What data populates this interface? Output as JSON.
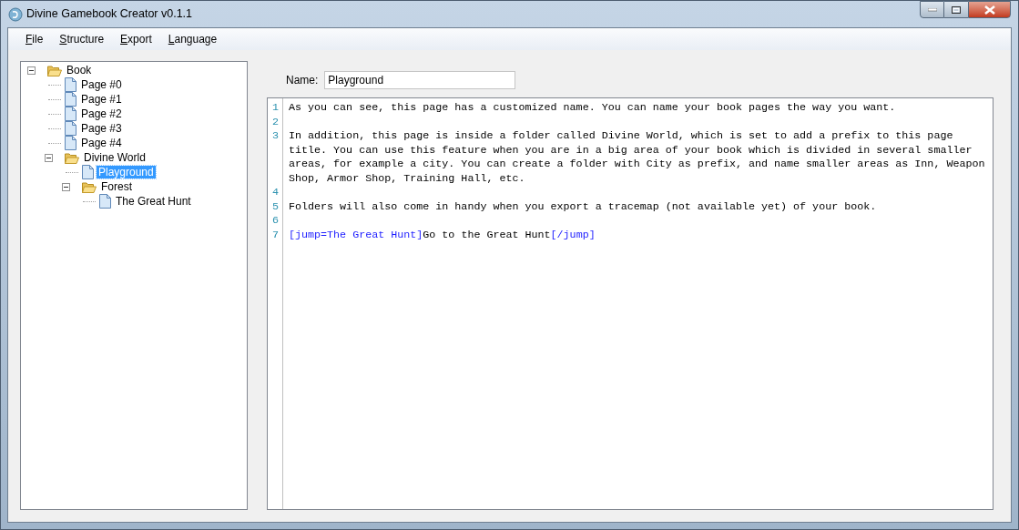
{
  "window": {
    "title": "Divine Gamebook Creator v0.1.1"
  },
  "menu": [
    {
      "label": "File"
    },
    {
      "label": "Structure"
    },
    {
      "label": "Export"
    },
    {
      "label": "Language"
    }
  ],
  "tree": [
    {
      "kind": "folder",
      "label": "Book",
      "expanded": true,
      "selected": false,
      "children": [
        {
          "kind": "page",
          "label": "Page #0",
          "selected": false
        },
        {
          "kind": "page",
          "label": "Page #1",
          "selected": false
        },
        {
          "kind": "page",
          "label": "Page #2",
          "selected": false
        },
        {
          "kind": "page",
          "label": "Page #3",
          "selected": false
        },
        {
          "kind": "page",
          "label": "Page #4",
          "selected": false
        },
        {
          "kind": "folder",
          "label": "Divine World",
          "expanded": true,
          "selected": false,
          "children": [
            {
              "kind": "page",
              "label": "Playground",
              "selected": true
            },
            {
              "kind": "folder",
              "label": "Forest",
              "expanded": true,
              "selected": false,
              "children": [
                {
                  "kind": "page",
                  "label": "The Great Hunt",
                  "selected": false
                }
              ]
            }
          ]
        }
      ]
    }
  ],
  "name_field": {
    "label": "Name:",
    "value": "Playground"
  },
  "editor": {
    "lines": [
      {
        "number": "1",
        "parts": [
          {
            "kind": "text",
            "text": "As you can see, this page has a customized name. You can name your book pages the way you want."
          }
        ]
      },
      {
        "number": "2"
      },
      {
        "number": "3",
        "parts": [
          {
            "kind": "text",
            "text": "In addition, this page is inside a folder called Divine World, which is set to add a prefix to this page title. You can use this feature when you are in a big area of your book which is divided in several smaller areas, for example a city. You can create a folder with City as prefix, and name smaller areas as Inn, Weapon Shop, Armor Shop, Training Hall, etc."
          }
        ]
      },
      {
        "number": "4"
      },
      {
        "number": "5",
        "parts": [
          {
            "kind": "text",
            "text": "Folders will also come in handy when you export a tracemap (not available yet) of your book."
          }
        ]
      },
      {
        "number": "6"
      },
      {
        "number": "7",
        "parts": [
          {
            "kind": "tag",
            "text": "[jump=The Great Hunt]"
          },
          {
            "kind": "text",
            "text": "Go to the Great Hunt"
          },
          {
            "kind": "tag",
            "text": "[/jump]"
          }
        ]
      }
    ]
  }
}
